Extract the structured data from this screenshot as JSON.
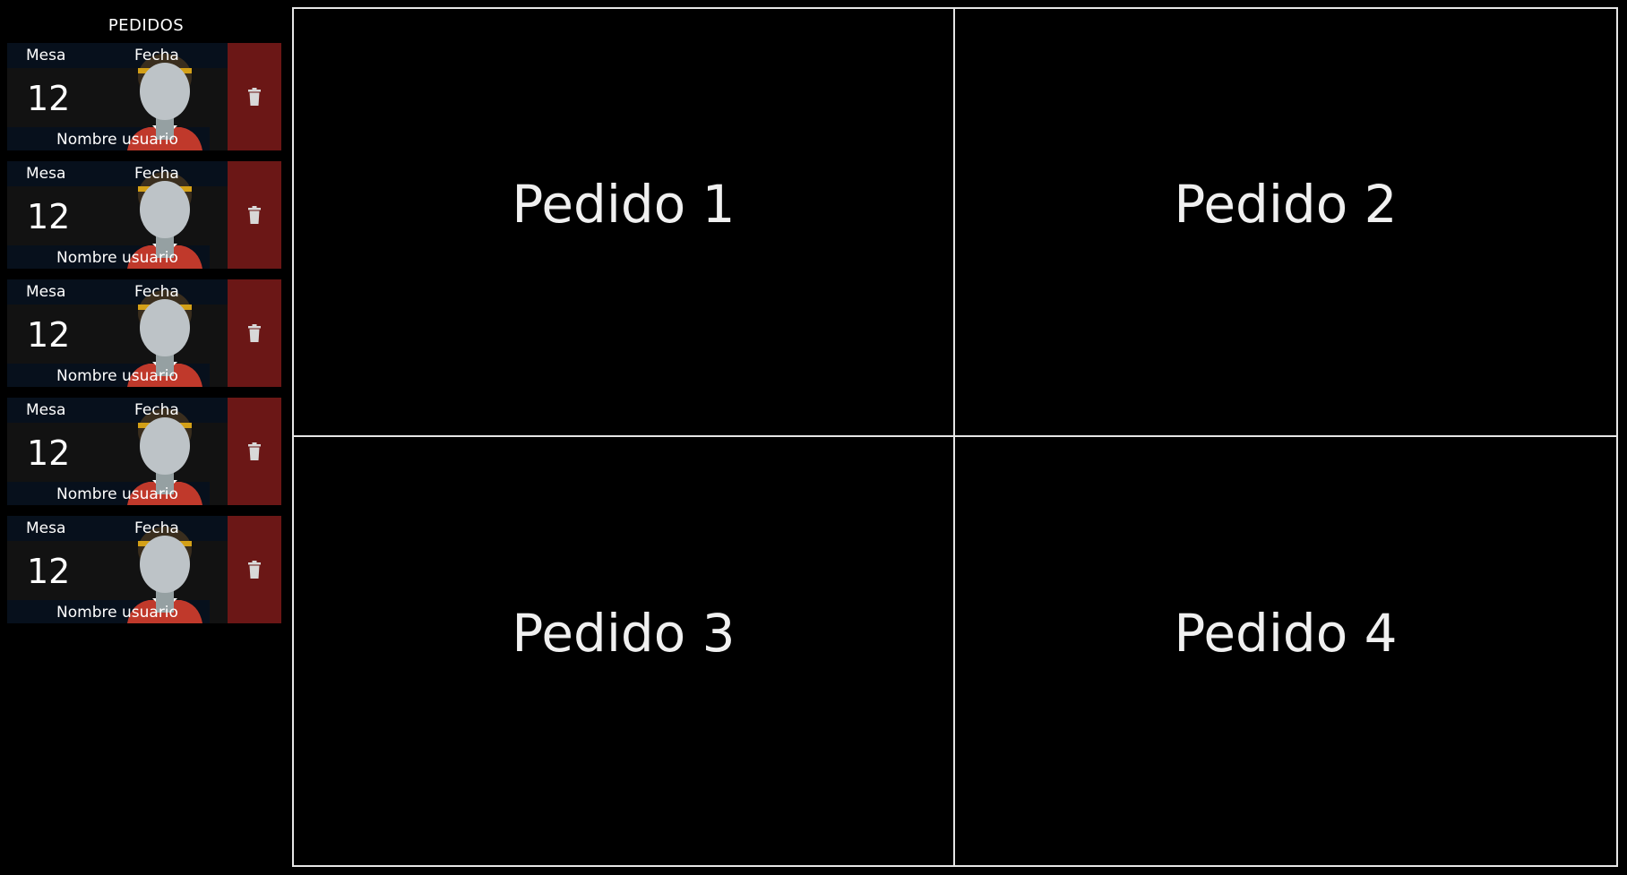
{
  "sidebar": {
    "title": "PEDIDOS",
    "orders": [
      {
        "mesa_label": "Mesa",
        "fecha_label": "Fecha",
        "table_number": "12",
        "user_name": "Nombre usuario",
        "delete_icon": "trash-icon"
      },
      {
        "mesa_label": "Mesa",
        "fecha_label": "Fecha",
        "table_number": "12",
        "user_name": "Nombre usuario",
        "delete_icon": "trash-icon"
      },
      {
        "mesa_label": "Mesa",
        "fecha_label": "Fecha",
        "table_number": "12",
        "user_name": "Nombre usuario",
        "delete_icon": "trash-icon"
      },
      {
        "mesa_label": "Mesa",
        "fecha_label": "Fecha",
        "table_number": "12",
        "user_name": "Nombre usuario",
        "delete_icon": "trash-icon"
      },
      {
        "mesa_label": "Mesa",
        "fecha_label": "Fecha",
        "table_number": "12",
        "user_name": "Nombre usuario",
        "delete_icon": "trash-icon"
      }
    ]
  },
  "panels": [
    {
      "label": "Pedido 1"
    },
    {
      "label": "Pedido 2"
    },
    {
      "label": "Pedido 3"
    },
    {
      "label": "Pedido 4"
    }
  ],
  "colors": {
    "background": "#000000",
    "card_background": "#121212",
    "card_bar": "#07101c",
    "delete_button": "#6b1716",
    "panel_border": "#e6e6e6"
  }
}
